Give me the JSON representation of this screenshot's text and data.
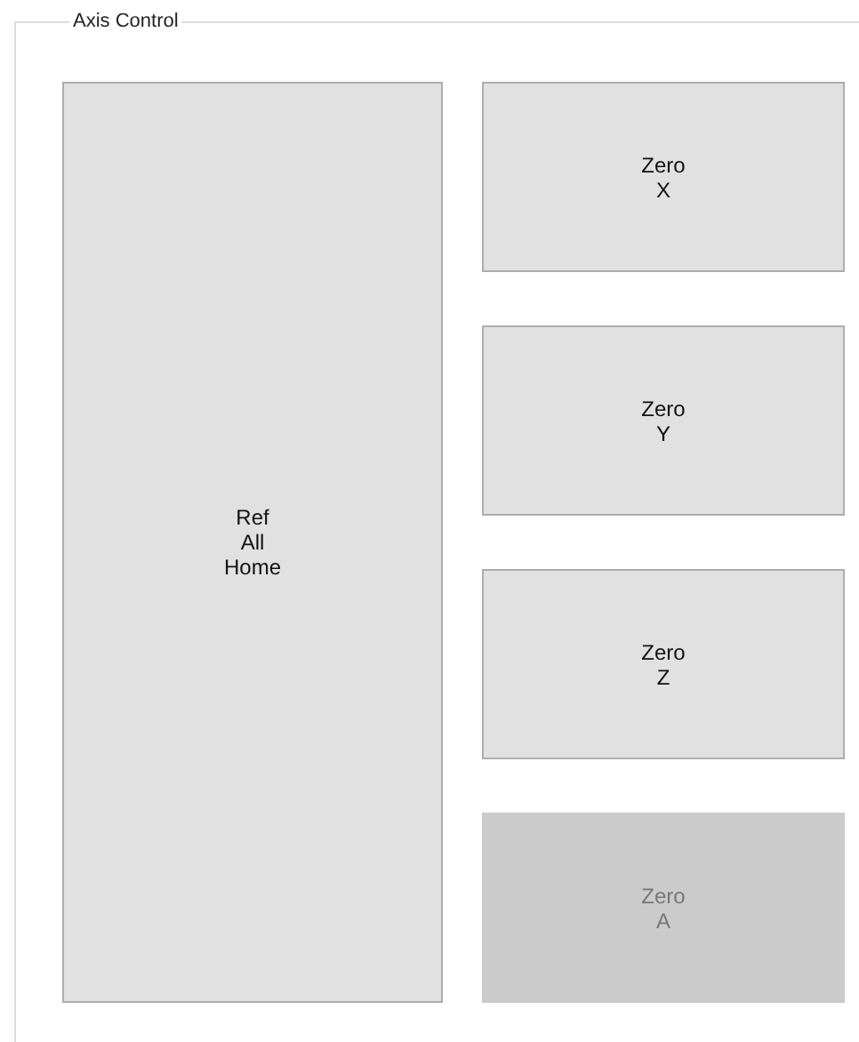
{
  "group": {
    "title": "Axis Control"
  },
  "home_button": {
    "label": "Ref\nAll\nHome",
    "disabled": false
  },
  "zero_buttons": [
    {
      "label": "Zero\nX",
      "disabled": false
    },
    {
      "label": "Zero\nY",
      "disabled": false
    },
    {
      "label": "Zero\nZ",
      "disabled": false
    },
    {
      "label": "Zero\nA",
      "disabled": true
    }
  ]
}
